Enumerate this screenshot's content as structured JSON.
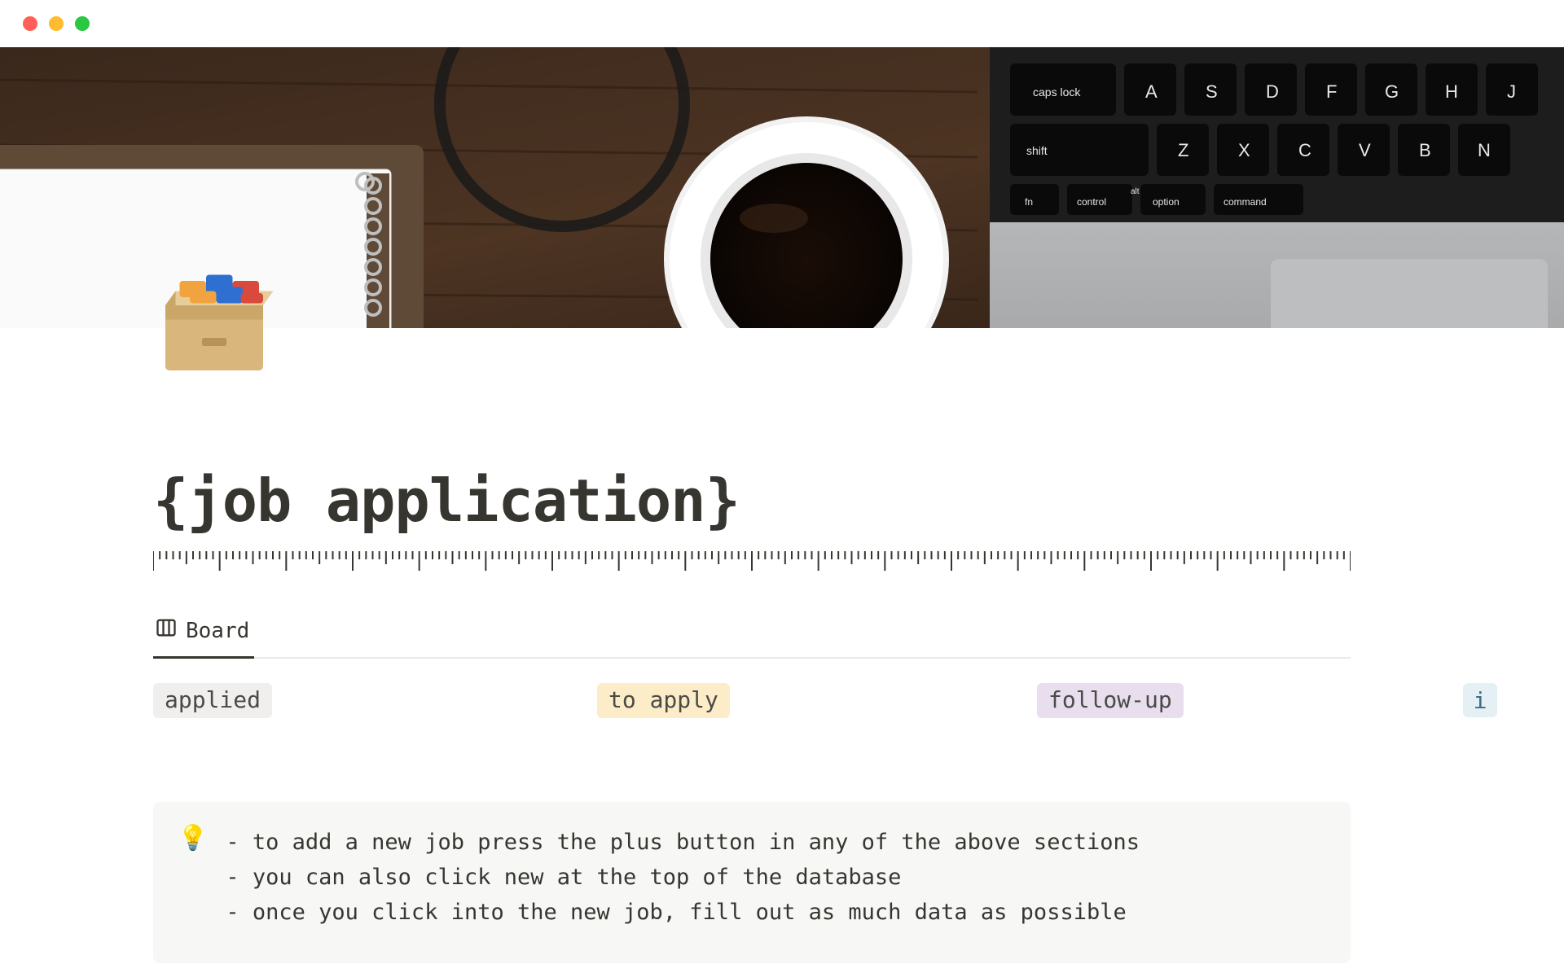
{
  "window": {
    "style": "mac"
  },
  "page": {
    "icon_name": "card-file-box",
    "title": "{job application}"
  },
  "tabs": [
    {
      "icon": "board-icon",
      "label": "Board"
    }
  ],
  "board_columns": [
    {
      "key": "applied",
      "label": "applied",
      "color": "gray"
    },
    {
      "key": "to-apply",
      "label": "to apply",
      "color": "yellow"
    },
    {
      "key": "follow-up",
      "label": "follow-up",
      "color": "purple"
    }
  ],
  "info_button": {
    "label": "i"
  },
  "callout": {
    "icon": "💡",
    "lines": [
      "- to add a new job press the plus button in any of the above sections",
      "- you can also click new at the top of the database",
      "- once you click into the new job, fill out as much data as possible"
    ]
  }
}
